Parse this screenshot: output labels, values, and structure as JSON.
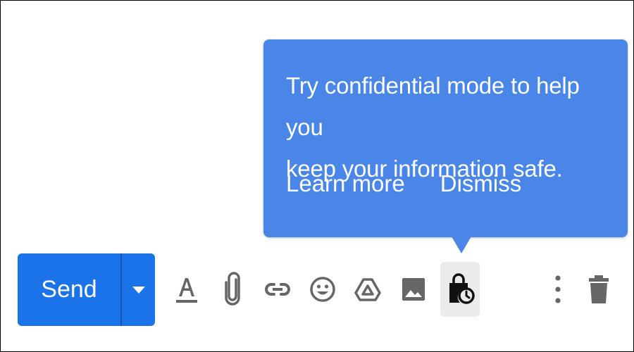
{
  "tooltip": {
    "message_line1": "Try confidential mode to help you",
    "message_line2": "keep your information safe.",
    "learn_more": "Learn more",
    "dismiss": "Dismiss"
  },
  "toolbar": {
    "send_label": "Send",
    "icons": [
      "formatting-options-icon",
      "attach-files-icon",
      "insert-link-icon",
      "insert-emoji-icon",
      "insert-drive-icon",
      "insert-photo-icon",
      "confidential-mode-icon",
      "more-options-icon",
      "discard-draft-icon"
    ]
  },
  "colors": {
    "tooltip_bg": "#4a86e8",
    "send_bg": "#1a73e8",
    "icon_gray": "#666666",
    "active_icon_bg": "#ebebeb"
  }
}
